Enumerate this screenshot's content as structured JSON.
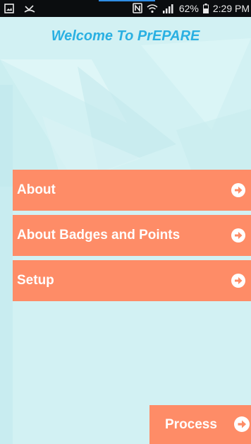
{
  "status_bar": {
    "battery": "62%",
    "time": "2:29 PM"
  },
  "app": {
    "title": "Welcome To PrEPARE"
  },
  "menu": {
    "items": [
      {
        "label": "About"
      },
      {
        "label": "About Badges and Points"
      },
      {
        "label": "Setup"
      }
    ]
  },
  "process_label": "Process",
  "colors": {
    "button": "#fe8c67",
    "title": "#2ab0e2",
    "background": "#d2f1f3"
  },
  "icons": {
    "menu_arrow": "arrow-right-circle-icon"
  }
}
